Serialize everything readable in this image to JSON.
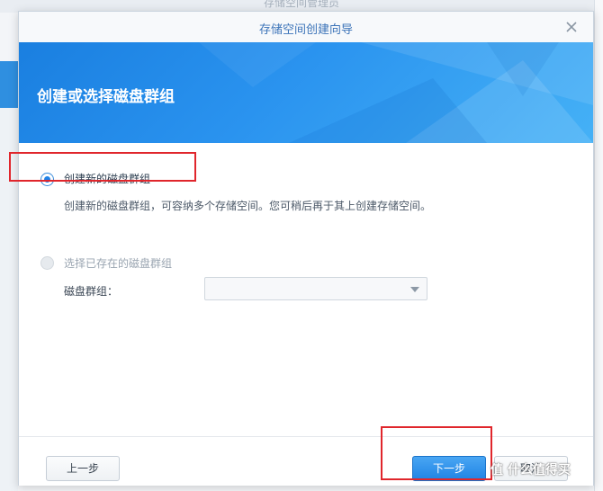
{
  "background": {
    "title": "存储空间管理员"
  },
  "dialog": {
    "title": "存储空间创建向导",
    "banner_title": "创建或选择磁盘群组",
    "option_create": {
      "label": "创建新的磁盘群组",
      "selected": true,
      "description": "创建新的磁盘群组，可容纳多个存储空间。您可稍后再于其上创建存储空间。"
    },
    "option_existing": {
      "label": "选择已存在的磁盘群组",
      "selected": false,
      "field_label": "磁盘群组：",
      "select_value": ""
    },
    "buttons": {
      "prev": "上一步",
      "next": "下一步",
      "cancel": "取消"
    }
  },
  "watermark": "值 什么值得买",
  "colors": {
    "accent": "#1d82e8",
    "highlight": "#e0262c",
    "banner": "#2a93ef"
  },
  "icons": {
    "close": "close-icon"
  }
}
